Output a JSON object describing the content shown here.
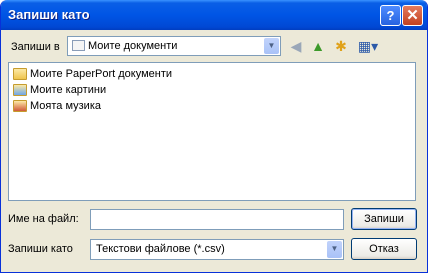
{
  "window": {
    "title": "Запиши като"
  },
  "titlebar_buttons": {
    "help": "?",
    "close": "✕"
  },
  "save_in": {
    "label": "Запиши в",
    "value": "Моите документи"
  },
  "toolbar_icons": [
    "back-arrow-icon",
    "up-folder-icon",
    "new-folder-icon",
    "view-menu-icon"
  ],
  "files": [
    {
      "name": "Моите PaperPort документи",
      "icon": "folder-icon"
    },
    {
      "name": "Моите картини",
      "icon": "pictures-folder-icon"
    },
    {
      "name": "Моята музика",
      "icon": "music-folder-icon"
    }
  ],
  "filename": {
    "label": "Име на файл:",
    "value": ""
  },
  "filetype": {
    "label": "Запиши като",
    "value": "Текстови файлове (*.csv)"
  },
  "buttons": {
    "save": "Запиши",
    "cancel": "Отказ"
  }
}
